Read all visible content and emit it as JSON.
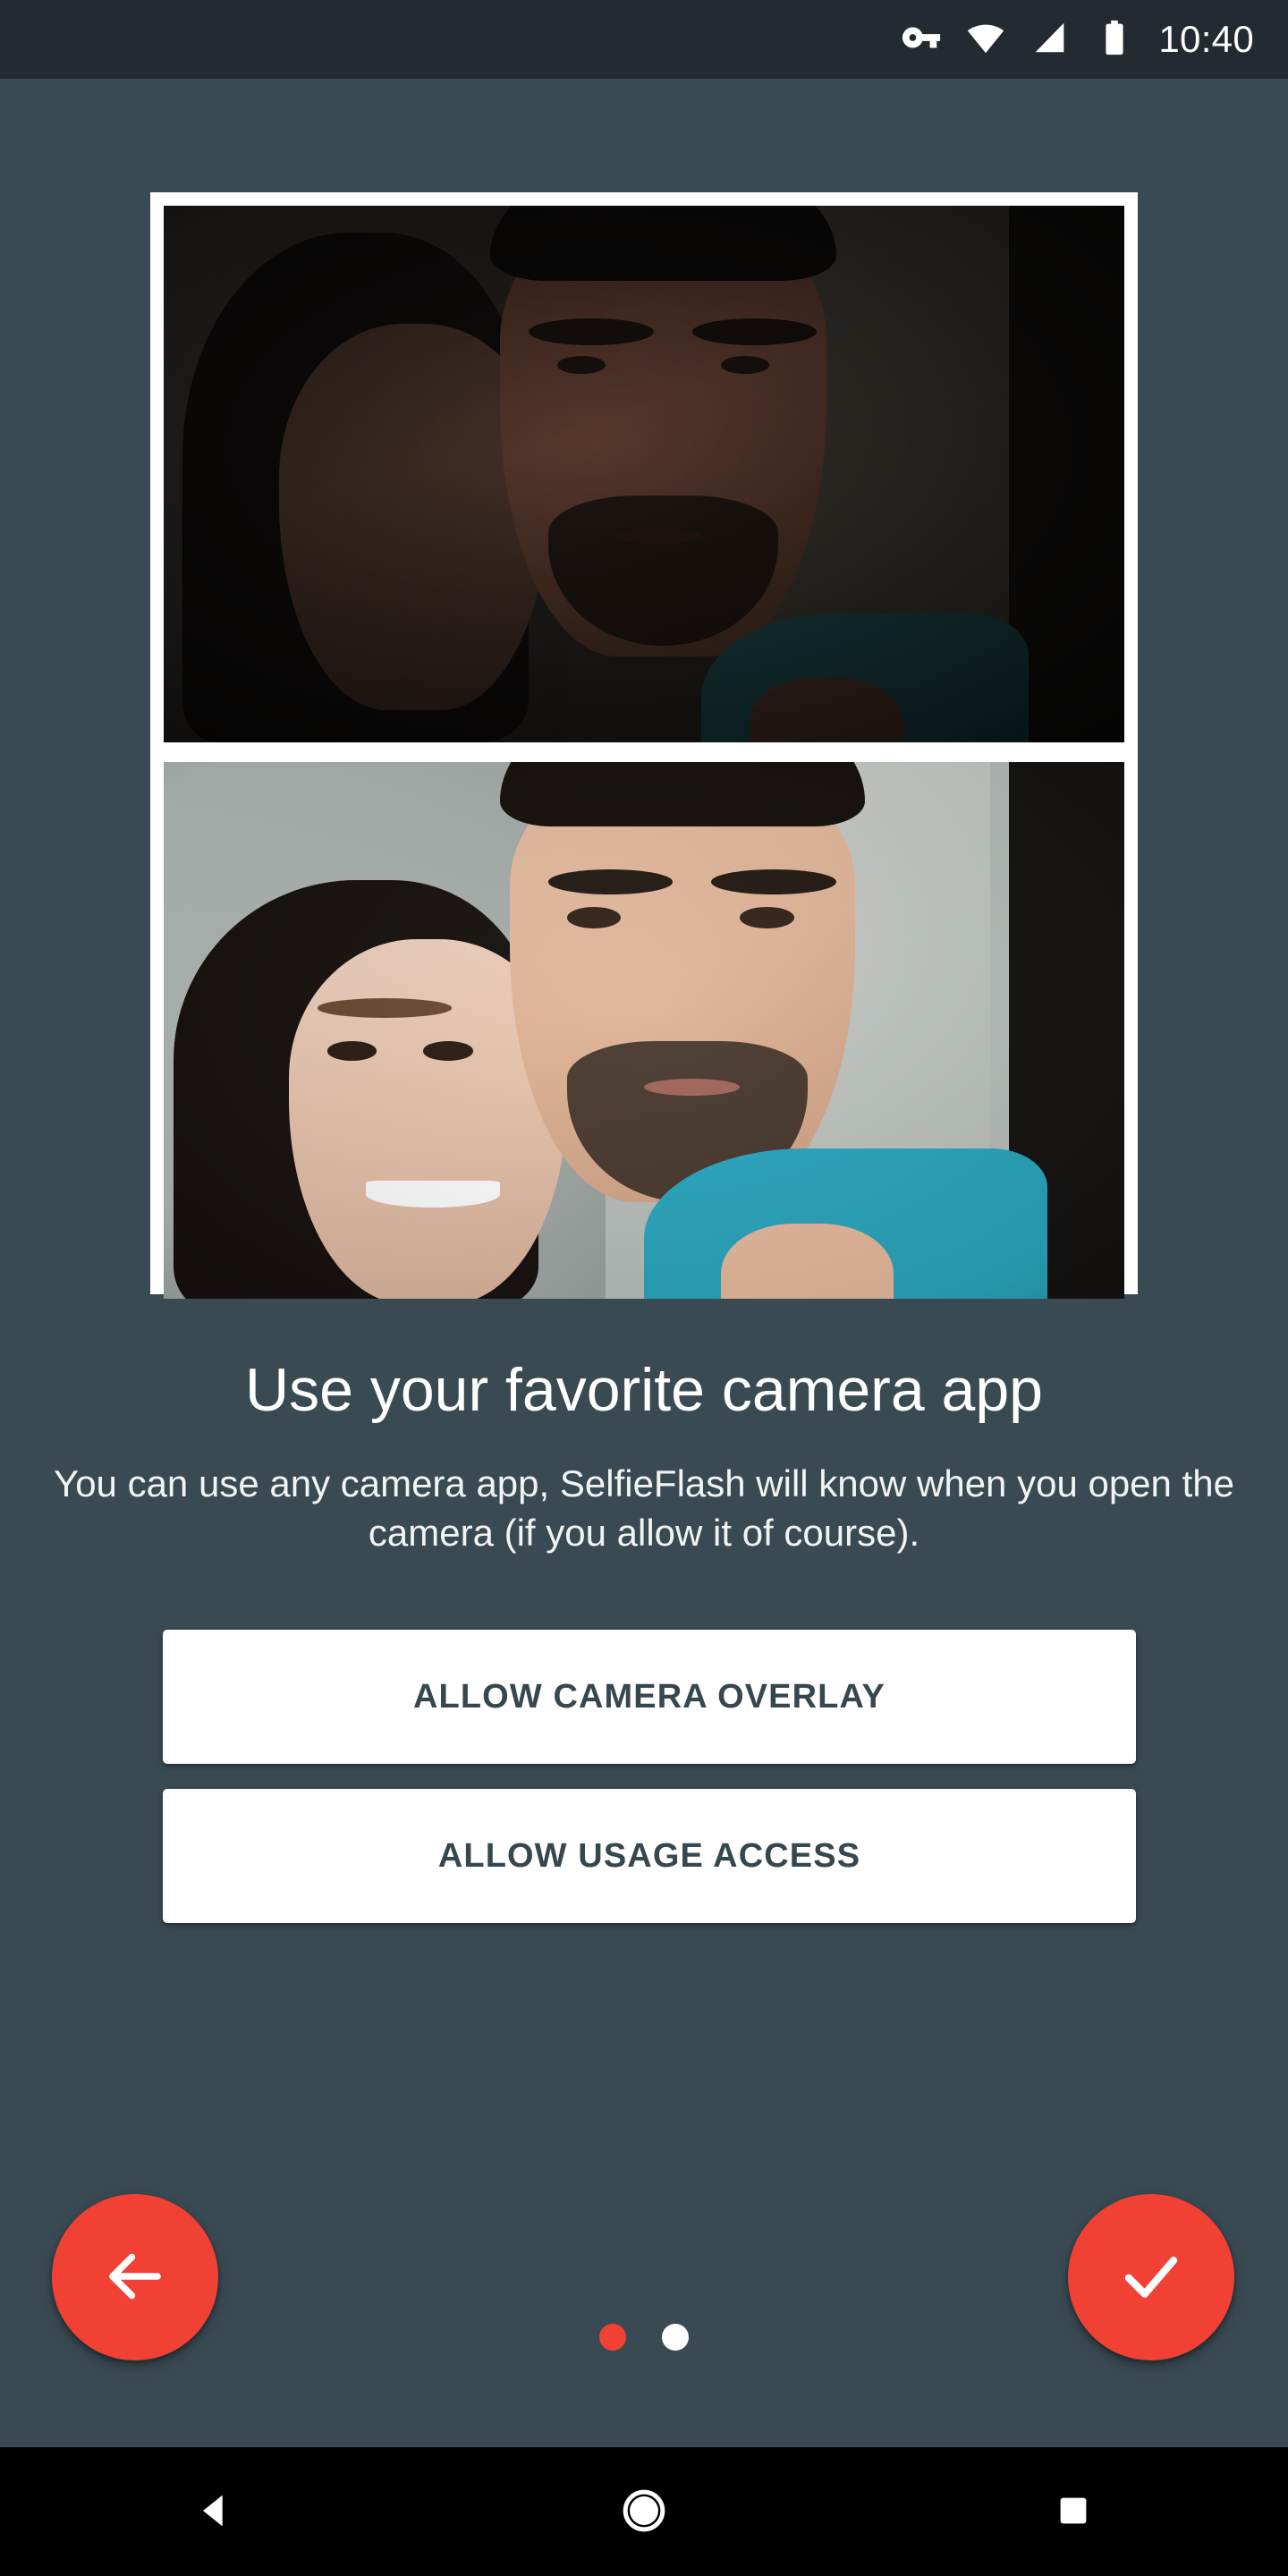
{
  "status_bar": {
    "clock": "10:40",
    "icons": [
      "vpn-key-icon",
      "wifi-icon",
      "cellular-signal-icon",
      "battery-icon"
    ],
    "background_color": "#232A31"
  },
  "screen": {
    "background_color": "#3A4A53",
    "accent_color": "#F04134",
    "surface_color": "#FFFFFF",
    "app_name": "SelfieFlash"
  },
  "showcase": {
    "frame_background": "#FFFFFF",
    "photos": [
      {
        "name": "before-photo",
        "description": "Dark underexposed selfie of a couple",
        "alt": "Couple selfie taken in low light without flash"
      },
      {
        "name": "after-photo",
        "description": "Bright well-lit selfie of the same couple",
        "alt": "Couple selfie taken with SelfieFlash screen flash"
      }
    ]
  },
  "content": {
    "headline": "Use your favorite camera app",
    "subtext": "You can use any camera app, SelfieFlash will know when you open the camera (if you allow it of course)."
  },
  "actions": {
    "camera_overlay_label": "ALLOW CAMERA OVERLAY",
    "usage_access_label": "ALLOW USAGE ACCESS"
  },
  "navigation": {
    "back_fab": "back-arrow-icon",
    "done_fab": "checkmark-icon",
    "page_dots": [
      {
        "state": "active",
        "color": "#F04134"
      },
      {
        "state": "inactive",
        "color": "#FFFFFF"
      }
    ],
    "total_pages": 2,
    "current_page": 1
  },
  "system_nav": {
    "back": "triangle-back-icon",
    "home": "circle-home-icon",
    "recents": "square-recents-icon",
    "background_color": "#000000"
  }
}
